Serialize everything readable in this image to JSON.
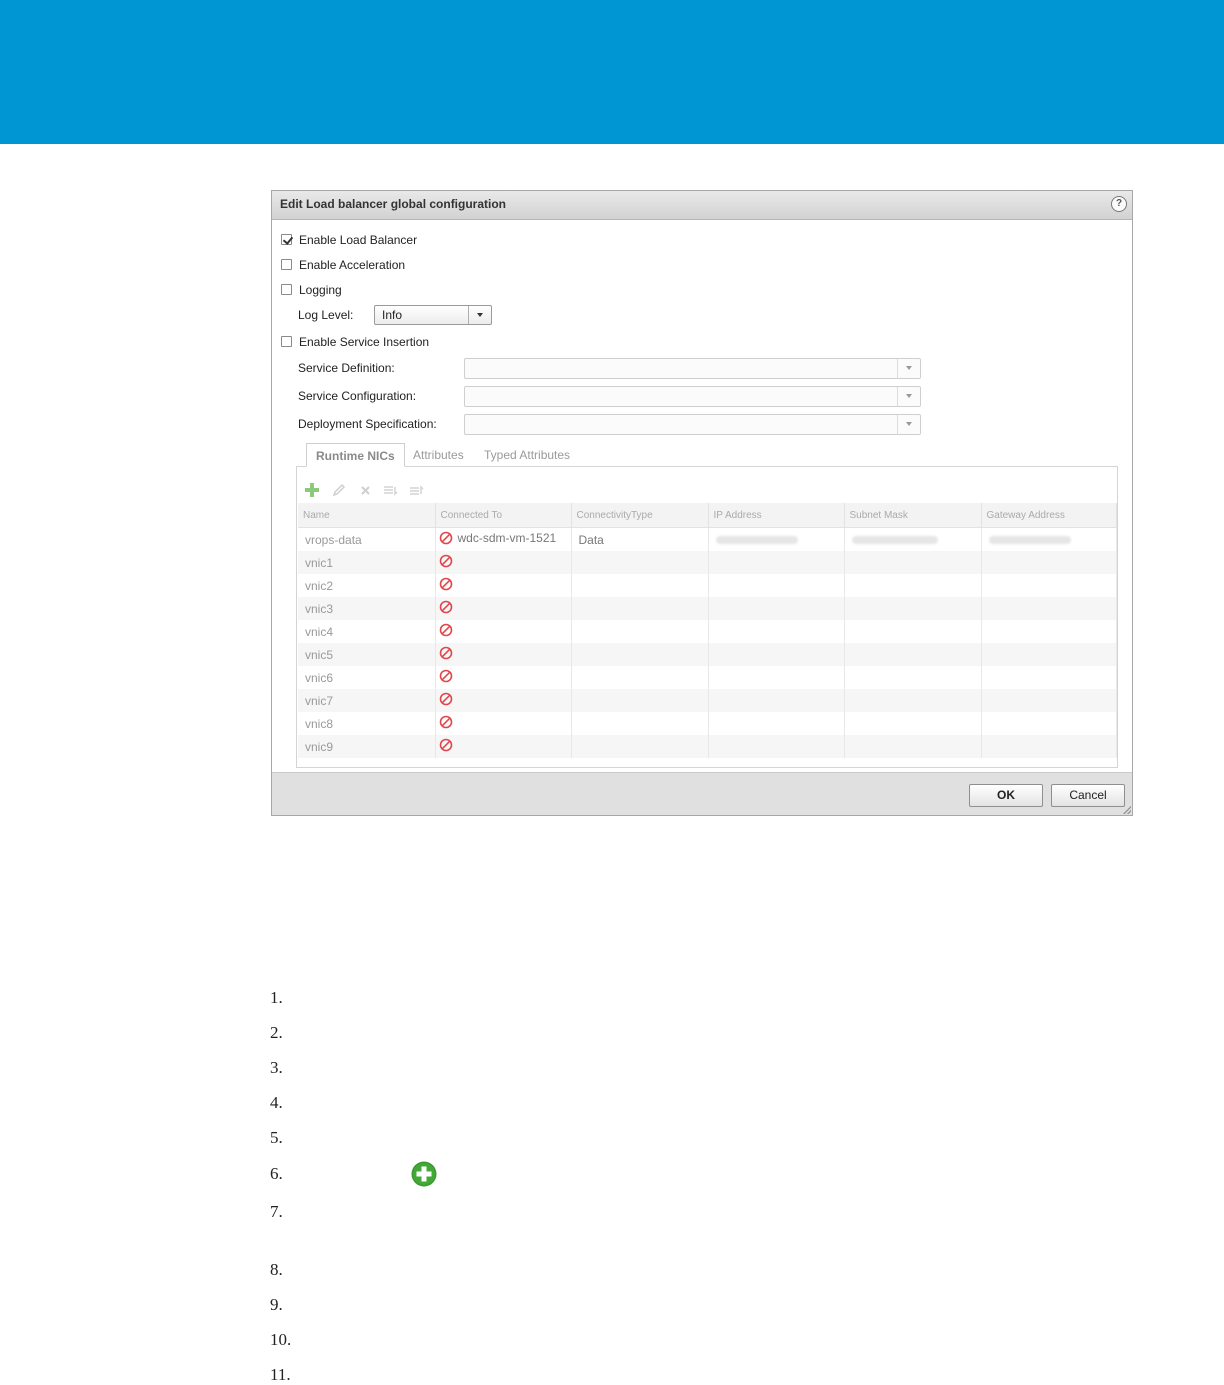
{
  "dialog": {
    "title": "Edit Load balancer global configuration",
    "help_symbol": "?",
    "options": {
      "enable_load_balancer": {
        "label": "Enable Load Balancer",
        "checked": true
      },
      "enable_acceleration": {
        "label": "Enable Acceleration",
        "checked": false
      },
      "logging": {
        "label": "Logging",
        "checked": false
      },
      "log_level": {
        "label": "Log Level:",
        "value": "Info"
      },
      "enable_service_insertion": {
        "label": "Enable Service Insertion",
        "checked": false
      }
    },
    "service_fields": [
      {
        "label": "Service Definition:",
        "value": ""
      },
      {
        "label": "Service Configuration:",
        "value": ""
      },
      {
        "label": "Deployment Specification:",
        "value": ""
      }
    ],
    "tabs": [
      {
        "label": "Runtime NICs",
        "active": true
      },
      {
        "label": "Attributes",
        "active": false
      },
      {
        "label": "Typed Attributes",
        "active": false
      }
    ],
    "toolbar_icons": [
      "add-icon",
      "edit-icon",
      "delete-icon",
      "move-down-icon",
      "move-up-icon"
    ],
    "grid": {
      "columns": [
        "Name",
        "Connected To",
        "ConnectivityType",
        "IP Address",
        "Subnet Mask",
        "Gateway Address"
      ],
      "rows": [
        {
          "name": "vrops-data",
          "connected_to": "wdc-sdm-vm-1521",
          "connectivity_type": "Data"
        },
        {
          "name": "vnic1",
          "connected_to": "",
          "connectivity_type": ""
        },
        {
          "name": "vnic2",
          "connected_to": "",
          "connectivity_type": ""
        },
        {
          "name": "vnic3",
          "connected_to": "",
          "connectivity_type": ""
        },
        {
          "name": "vnic4",
          "connected_to": "",
          "connectivity_type": ""
        },
        {
          "name": "vnic5",
          "connected_to": "",
          "connectivity_type": ""
        },
        {
          "name": "vnic6",
          "connected_to": "",
          "connectivity_type": ""
        },
        {
          "name": "vnic7",
          "connected_to": "",
          "connectivity_type": ""
        },
        {
          "name": "vnic8",
          "connected_to": "",
          "connectivity_type": ""
        },
        {
          "name": "vnic9",
          "connected_to": "",
          "connectivity_type": ""
        }
      ]
    },
    "buttons": {
      "ok": "OK",
      "cancel": "Cancel"
    }
  },
  "steps": [
    "1.",
    "2.",
    "3.",
    "4.",
    "5.",
    "6.",
    "7.",
    "8.",
    "9.",
    "10.",
    "11."
  ],
  "colors": {
    "banner": "#0095d3",
    "add_green": "#3a9a2e",
    "not_connected_red": "#e0474c"
  }
}
